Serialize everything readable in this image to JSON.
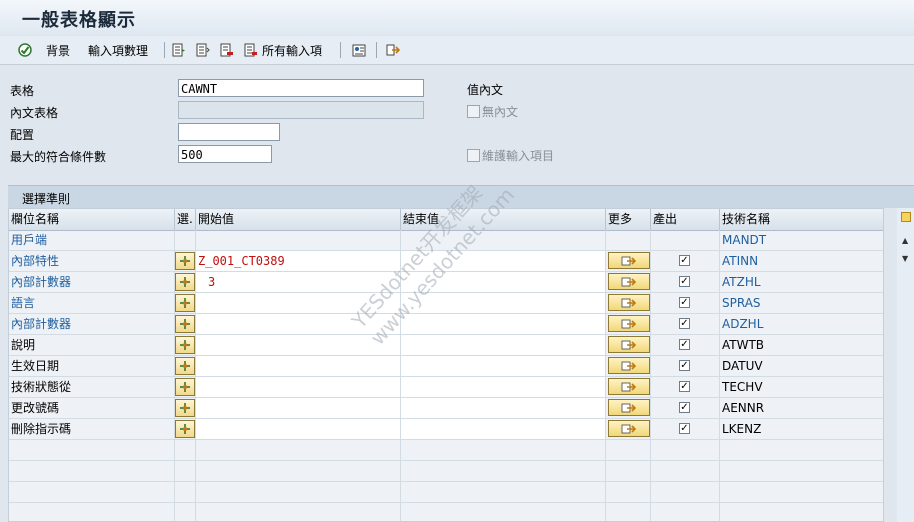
{
  "window": {
    "title": "一般表格顯示"
  },
  "toolbar": {
    "background_label": "背景",
    "input_count_label": "輸入項數理",
    "all_entries_label": "所有輸入項"
  },
  "form": {
    "table_label": "表格",
    "table_value": "CAWNT",
    "text_table_label": "內文表格",
    "text_table_value": "",
    "layout_label": "配置",
    "layout_value": "",
    "max_hits_label": "最大的符合條件數",
    "max_hits_value": "500",
    "value_text_label": "值內文",
    "no_text_label": "無內文",
    "maintain_entries_label": "維護輸入項目"
  },
  "section": {
    "title": "選擇準則"
  },
  "grid": {
    "headers": {
      "field_name": "欄位名稱",
      "select": "選.",
      "from": "開始值",
      "to": "結束值",
      "more": "更多",
      "output": "產出",
      "tech_name": "技術名稱"
    },
    "rows": [
      {
        "name": "用戶端",
        "from": "",
        "tech": "MANDT"
      },
      {
        "name": "內部特性",
        "from": "Z_001_CT0389",
        "tech": "ATINN"
      },
      {
        "name": "內部計數器",
        "from": "3",
        "tech": "ATZHL"
      },
      {
        "name": "語言",
        "from": "",
        "tech": "SPRAS"
      },
      {
        "name": "內部計數器",
        "from": "",
        "tech": "ADZHL"
      },
      {
        "name": "說明",
        "from": "",
        "tech": "ATWTB"
      },
      {
        "name": "生效日期",
        "from": "",
        "tech": "DATUV"
      },
      {
        "name": "技術狀態從",
        "from": "",
        "tech": "TECHV"
      },
      {
        "name": "更改號碼",
        "from": "",
        "tech": "AENNR"
      },
      {
        "name": "刪除指示碼",
        "from": "",
        "tech": "LKENZ"
      }
    ]
  },
  "colors": {
    "link": "#1f5fa0",
    "value_red": "#c01010",
    "background": "#dfe6ee"
  }
}
